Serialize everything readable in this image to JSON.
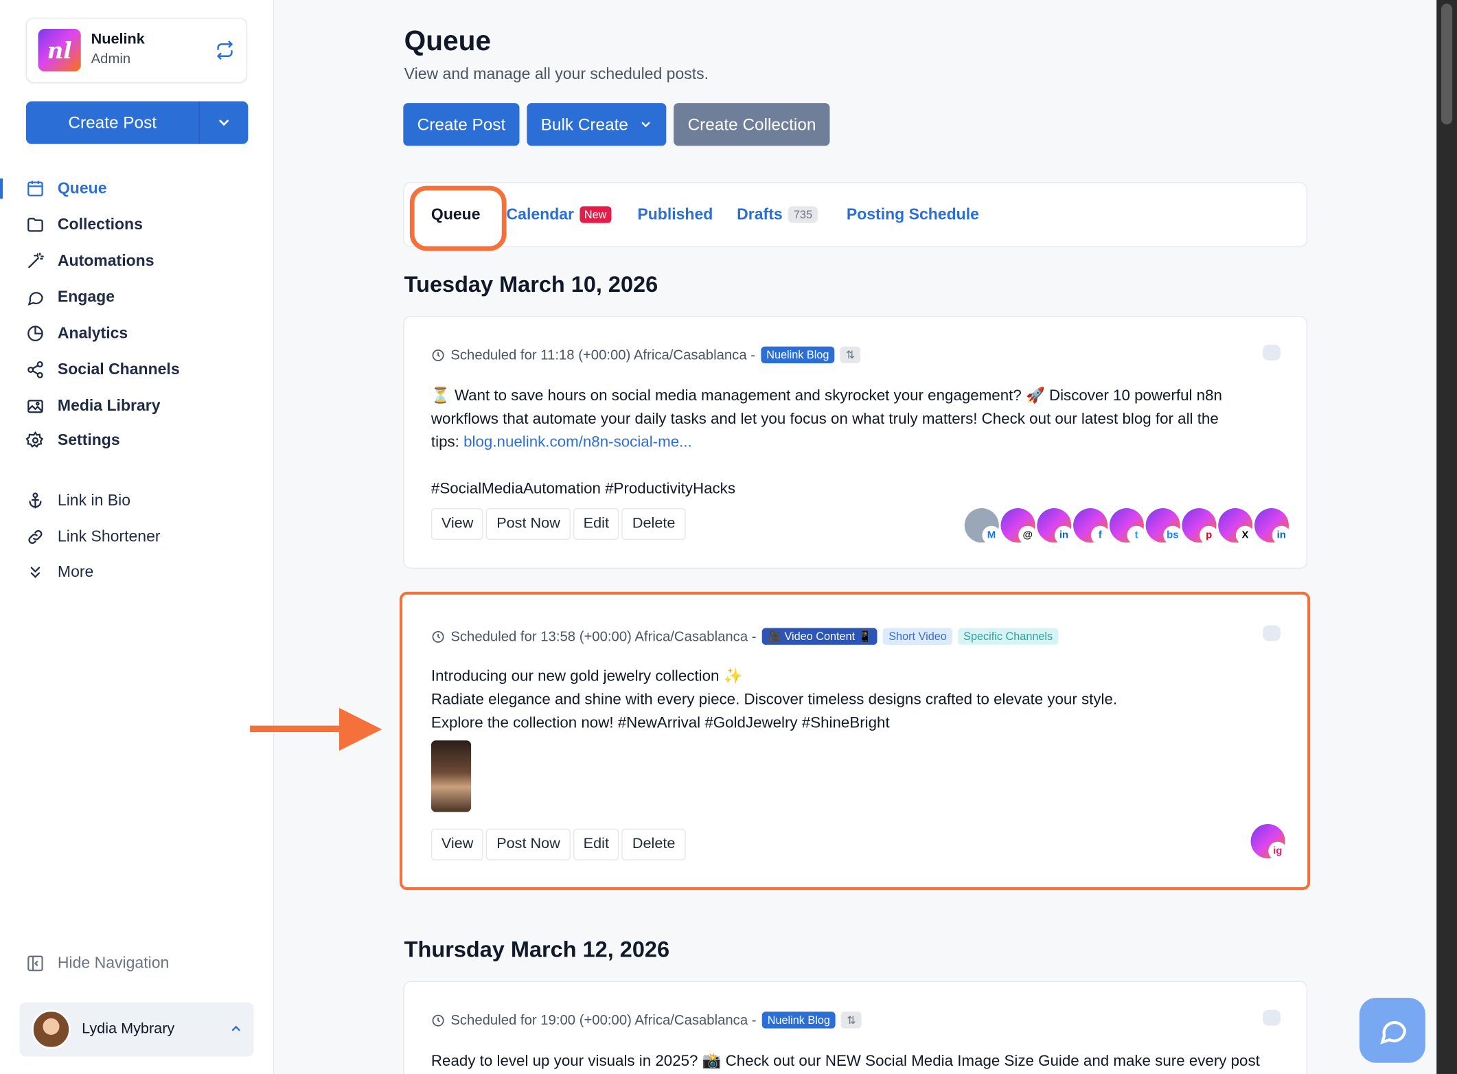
{
  "workspace": {
    "name": "Nuelink",
    "role": "Admin",
    "logo_text": "nl"
  },
  "sidebar": {
    "create_label": "Create Post",
    "items": [
      {
        "label": "Queue",
        "icon": "calendar-icon"
      },
      {
        "label": "Collections",
        "icon": "folder-icon"
      },
      {
        "label": "Automations",
        "icon": "magic-wand-icon"
      },
      {
        "label": "Engage",
        "icon": "chat-bubble-icon"
      },
      {
        "label": "Analytics",
        "icon": "pie-chart-icon"
      },
      {
        "label": "Social Channels",
        "icon": "share-icon"
      },
      {
        "label": "Media Library",
        "icon": "image-icon"
      },
      {
        "label": "Settings",
        "icon": "gear-icon"
      }
    ],
    "secondary": [
      {
        "label": "Link in Bio",
        "icon": "anchor-icon"
      },
      {
        "label": "Link Shortener",
        "icon": "link-icon"
      },
      {
        "label": "More",
        "icon": "chevrons-down-icon"
      }
    ],
    "hide_nav": "Hide Navigation",
    "user": "Lydia Mybrary"
  },
  "header": {
    "title": "Queue",
    "subtitle": "View and manage all your scheduled posts.",
    "buttons": {
      "create_post": "Create Post",
      "bulk_create": "Bulk Create",
      "create_collection": "Create Collection"
    }
  },
  "tabs": {
    "queue": "Queue",
    "calendar": "Calendar",
    "calendar_badge": "New",
    "published": "Published",
    "drafts": "Drafts",
    "drafts_count": "735",
    "posting_schedule": "Posting Schedule"
  },
  "days": [
    {
      "heading": "Tuesday March 10, 2026",
      "posts": [
        {
          "schedule": "Scheduled for 11:18 (+00:00) Africa/Casablanca -",
          "tags": [
            "Nuelink Blog"
          ],
          "line1": "⏳ Want to save hours on social media management and skyrocket your engagement? 🚀 Discover 10 powerful n8n",
          "line2": "workflows that automate your daily tasks and let you focus on what truly matters! Check out our latest blog for all the",
          "line3_prefix": "tips: ",
          "link": "blog.nuelink.com/n8n-social-me...",
          "hashtags": "#SocialMediaAutomation #ProductivityHacks",
          "channels": [
            "M",
            "@",
            "in",
            "f",
            "t",
            "bs",
            "p",
            "X",
            "in"
          ]
        },
        {
          "schedule": "Scheduled for 13:58 (+00:00) Africa/Casablanca -",
          "tags": [
            "🎥 Video Content 📱",
            "Short Video",
            "Specific Channels"
          ],
          "line1": "Introducing our new gold jewelry collection ✨",
          "line2": "Radiate elegance and shine with every piece. Discover timeless designs crafted to elevate your style.",
          "line3": "Explore the collection now! #NewArrival #GoldJewelry #ShineBright",
          "channels": [
            "ig"
          ]
        }
      ]
    },
    {
      "heading": "Thursday March 12, 2026",
      "posts": [
        {
          "schedule": "Scheduled for 19:00 (+00:00) Africa/Casablanca -",
          "tags": [
            "Nuelink Blog"
          ],
          "line1": "Ready to level up your visuals in 2025? 📸 Check out our NEW Social Media Image Size Guide and make sure every post"
        }
      ]
    }
  ],
  "post_actions": {
    "view": "View",
    "post_now": "Post Now",
    "edit": "Edit",
    "delete": "Delete"
  },
  "colors": {
    "accent": "#2b6fd6",
    "highlight": "#f4713c",
    "badge_red": "#e11d48"
  }
}
